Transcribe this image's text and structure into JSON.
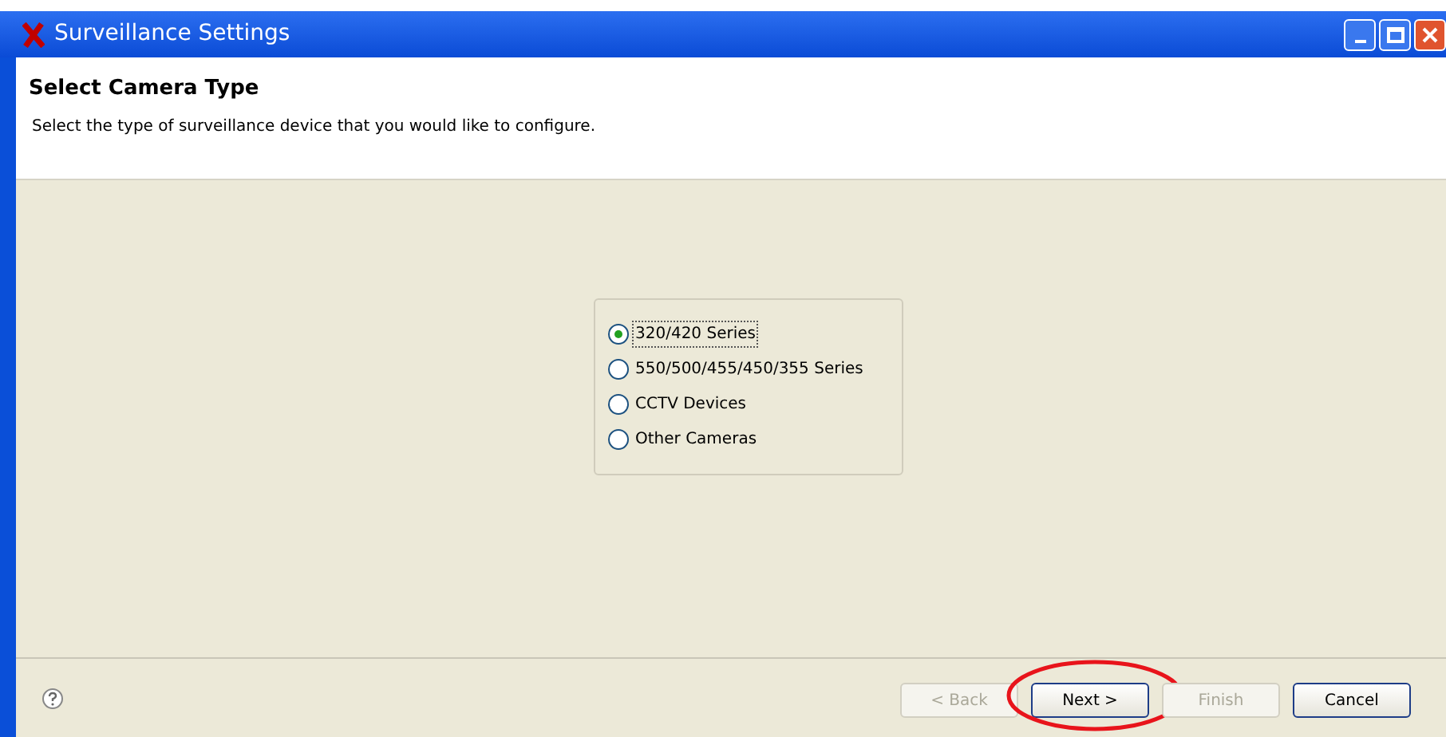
{
  "window": {
    "title": "Surveillance Settings"
  },
  "header": {
    "title": "Select Camera Type",
    "description": "Select the type of surveillance device that you would like to configure."
  },
  "options": [
    {
      "label": "320/420 Series",
      "selected": true
    },
    {
      "label": "550/500/455/450/355 Series",
      "selected": false
    },
    {
      "label": "CCTV Devices",
      "selected": false
    },
    {
      "label": "Other Cameras",
      "selected": false
    }
  ],
  "buttons": [
    {
      "label": "< Back",
      "disabled": true,
      "circled": false
    },
    {
      "label": "Next >",
      "disabled": false,
      "circled": true
    },
    {
      "label": "Finish",
      "disabled": true,
      "circled": false
    },
    {
      "label": "Cancel",
      "disabled": false,
      "circled": false
    }
  ]
}
